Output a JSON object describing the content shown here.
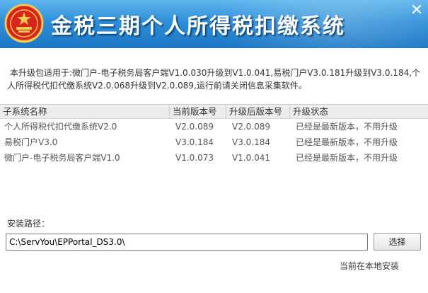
{
  "window": {
    "title": "金税三期个人所得税扣缴系统",
    "close_icon": "close-icon",
    "emblem_icon": "national-emblem-icon",
    "colors": {
      "titlebar_top": "#5fb6ee",
      "titlebar_bottom": "#1c76c4",
      "emblem_red": "#d8241c",
      "emblem_gold": "#f2c94c"
    }
  },
  "description": "本升级包适用于:微门户-电子税务局客户端V1.0.030升级到V1.0.041,易税门户V3.0.181升级到V3.0.184,个人所得税代扣代缴系统V2.0.068升级到V2.0.089,运行前请关闭信息采集软件。",
  "table": {
    "headers": [
      "子系统名称",
      "当前版本号",
      "升级后版本号",
      "升级状态"
    ],
    "rows": [
      [
        "个人所得税代扣代缴系统V2.0",
        "V2.0.089",
        "V2.0.089",
        "已经是最新版本，不用升级"
      ],
      [
        "易税门户V3.0",
        "V3.0.184",
        "V3.0.184",
        "已经是最新版本，不用升级"
      ],
      [
        "微门户-电子税务局客户端V1.0",
        "V1.0.073",
        "V1.0.041",
        "已经是最新版本，不用升级"
      ]
    ]
  },
  "install": {
    "label": "安装路径：",
    "path_value": "C:\\ServYou\\EPPortal_DS3.0\\",
    "browse_label": "选择",
    "status": "当前在本地安装"
  }
}
